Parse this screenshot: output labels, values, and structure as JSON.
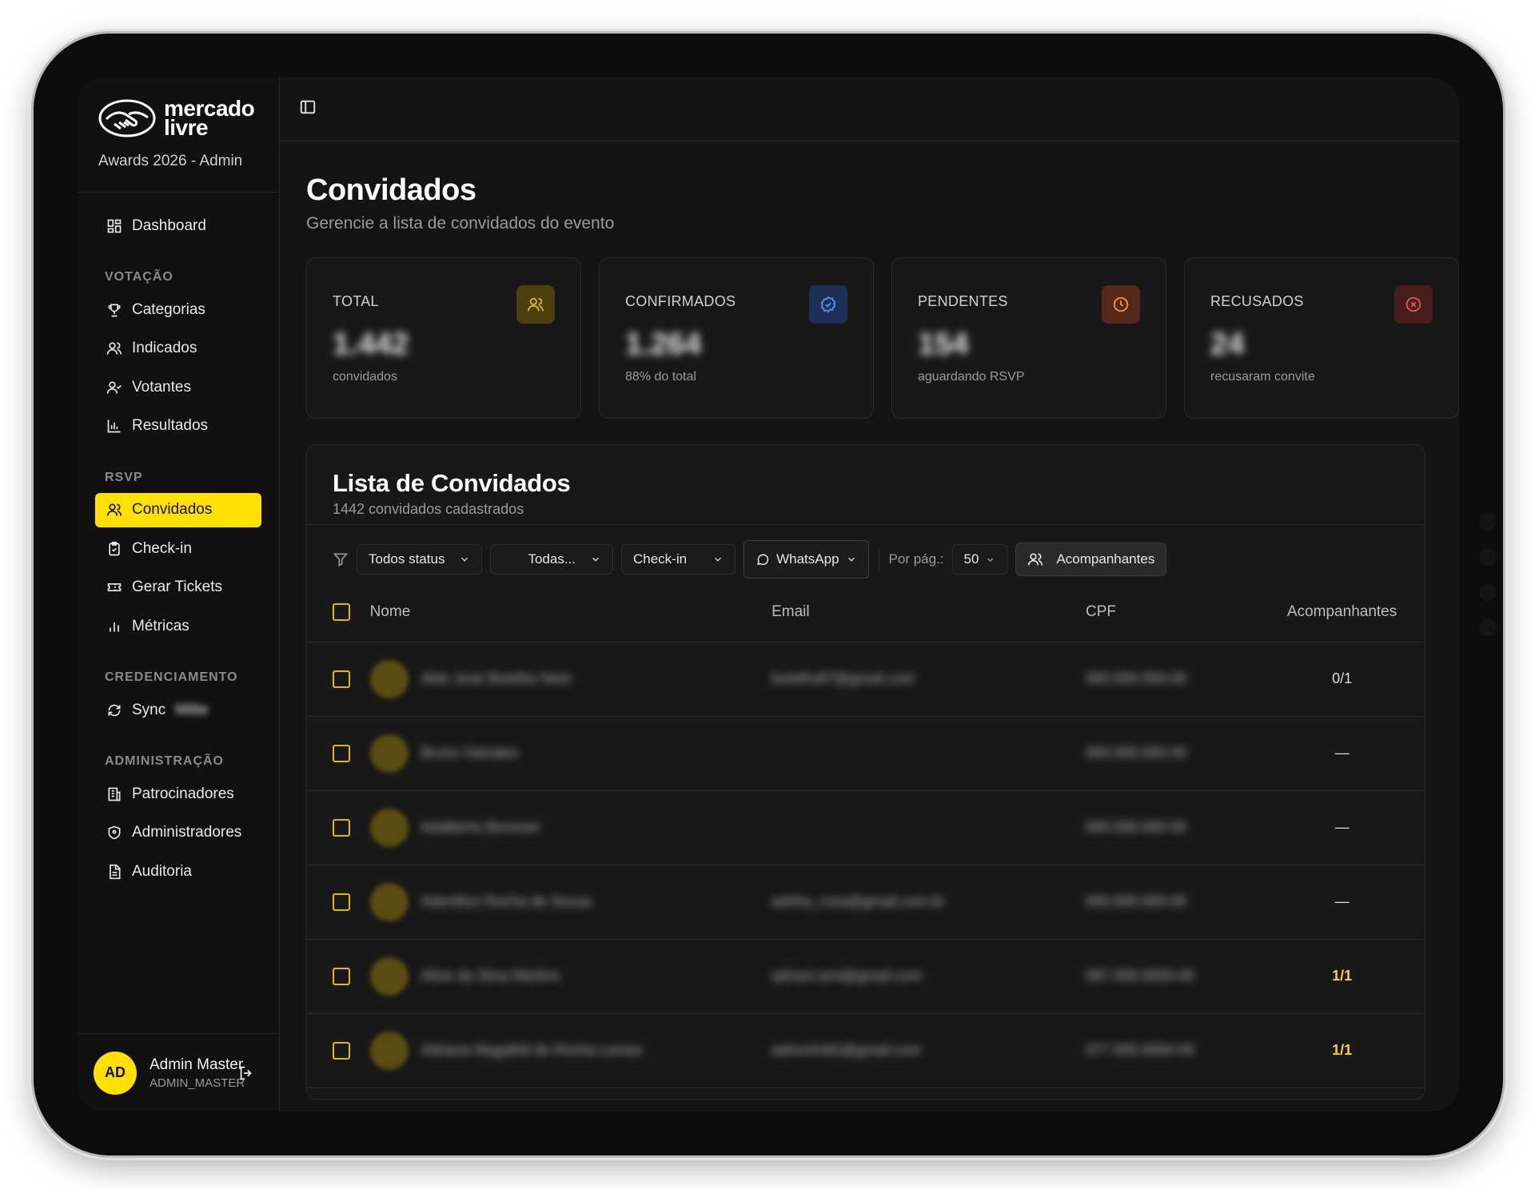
{
  "brand": {
    "name_line1": "mercado",
    "name_line2": "livre",
    "subtitle": "Awards 2026 - Admin"
  },
  "sidebar": {
    "top_items": [
      {
        "label": "Dashboard",
        "icon": "dashboard-icon"
      }
    ],
    "sections": [
      {
        "title": "VOTAÇÃO",
        "items": [
          {
            "label": "Categorias",
            "icon": "trophy-icon"
          },
          {
            "label": "Indicados",
            "icon": "users-icon"
          },
          {
            "label": "Votantes",
            "icon": "user-check-icon"
          },
          {
            "label": "Resultados",
            "icon": "bar-chart-icon"
          }
        ]
      },
      {
        "title": "RSVP",
        "items": [
          {
            "label": "Convidados",
            "icon": "users-icon",
            "active": true
          },
          {
            "label": "Check-in",
            "icon": "clipboard-check-icon"
          },
          {
            "label": "Gerar Tickets",
            "icon": "ticket-icon"
          },
          {
            "label": "Métricas",
            "icon": "metrics-icon"
          }
        ]
      },
      {
        "title": "CREDENCIAMENTO",
        "items": [
          {
            "label": "Sync",
            "label_blurred": "Mitte",
            "icon": "sync-icon"
          }
        ]
      },
      {
        "title": "ADMINISTRAÇÃO",
        "items": [
          {
            "label": "Patrocinadores",
            "icon": "building-icon"
          },
          {
            "label": "Administradores",
            "icon": "shield-icon"
          },
          {
            "label": "Auditoria",
            "icon": "file-text-icon"
          }
        ]
      }
    ],
    "user": {
      "initials": "AD",
      "name": "Admin Master",
      "role": "ADMIN_MASTER"
    }
  },
  "page": {
    "title": "Convidados",
    "subtitle": "Gerencie a lista de convidados do evento"
  },
  "stats": [
    {
      "label": "TOTAL",
      "value": "1.442",
      "note": "convidados",
      "icon": "users-icon",
      "icon_bg": "#5a4a10",
      "icon_color": "#d9b62a"
    },
    {
      "label": "CONFIRMADOS",
      "value": "1.264",
      "note": "88% do total",
      "icon": "check-badge-icon",
      "icon_bg": "#1d2f55",
      "icon_color": "#5b8cf0"
    },
    {
      "label": "PENDENTES",
      "value": "154",
      "note": "aguardando RSVP",
      "icon": "clock-icon",
      "icon_bg": "#55281a",
      "icon_color": "#f29a3a"
    },
    {
      "label": "RECUSADOS",
      "value": "24",
      "note": "recusaram convite",
      "icon": "x-icon",
      "icon_bg": "#4a1d1d",
      "icon_color": "#e05555"
    }
  ],
  "list": {
    "title": "Lista de Convidados",
    "subtitle": "1442 convidados cadastrados",
    "filters": {
      "status": "Todos status",
      "category": "Todas...",
      "checkin": "Check-in",
      "whatsapp": "WhatsApp",
      "per_page_label": "Por pág.:",
      "per_page": "50",
      "companions_button": "Acompanhantes"
    },
    "columns": {
      "name": "Nome",
      "email": "Email",
      "cpf": "CPF",
      "companions": "Acompanhantes"
    },
    "rows": [
      {
        "name": "Aldo José Botelho Neto",
        "email": "botelho87@gmail.com",
        "cpf": "000.000.000-00",
        "companions": "0/1",
        "highlight": false
      },
      {
        "name": "Bruno Vieirales",
        "email": "",
        "cpf": "000.000.000-00",
        "companions": "—",
        "highlight": false
      },
      {
        "name": "Adalberto Boneser",
        "email": "",
        "cpf": "000.000.000-00",
        "companions": "—",
        "highlight": false
      },
      {
        "name": "Adenilton Rocha de Sousa",
        "email": "adriha_rosa@gmail.com.br",
        "cpf": "000.000.000-00",
        "companions": "—",
        "highlight": false
      },
      {
        "name": "Aline da Silva Martins",
        "email": "adriani.ami@gmail.com",
        "cpf": "087.000.0000-00",
        "companions": "1/1",
        "highlight": true
      },
      {
        "name": "Adriana Magalhã de Rocha Lemes",
        "email": "adrivnimkh@gmail.com",
        "cpf": "077.000.0000-00",
        "companions": "1/1",
        "highlight": true
      }
    ]
  }
}
